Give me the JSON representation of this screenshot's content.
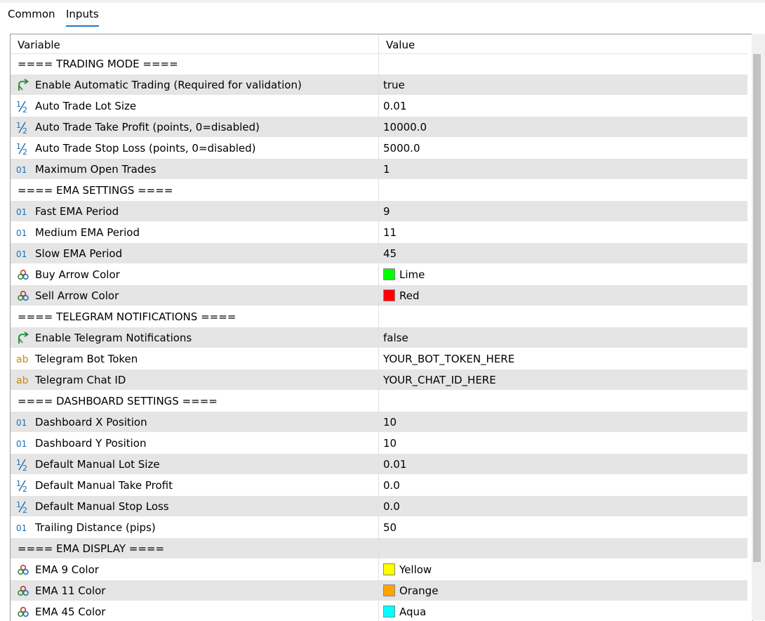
{
  "tabs": [
    {
      "label": "Common",
      "active": false
    },
    {
      "label": "Inputs",
      "active": true
    }
  ],
  "columns": {
    "variable": "Variable",
    "value": "Value"
  },
  "rows": [
    {
      "type": "section",
      "label": "==== TRADING MODE ===="
    },
    {
      "type": "bool",
      "icon": "bool-arrow-icon",
      "label": "Enable Automatic Trading (Required for validation)",
      "value": "true"
    },
    {
      "type": "double",
      "icon": "half-fraction-icon",
      "label": "Auto Trade Lot Size",
      "value": "0.01"
    },
    {
      "type": "double",
      "icon": "half-fraction-icon",
      "label": "Auto Trade Take Profit (points, 0=disabled)",
      "value": "10000.0"
    },
    {
      "type": "double",
      "icon": "half-fraction-icon",
      "label": "Auto Trade Stop Loss (points, 0=disabled)",
      "value": "5000.0"
    },
    {
      "type": "int",
      "icon": "integer-01-icon",
      "label": "Maximum Open Trades",
      "value": "1"
    },
    {
      "type": "section",
      "label": "==== EMA SETTINGS ===="
    },
    {
      "type": "int",
      "icon": "integer-01-icon",
      "label": "Fast EMA Period",
      "value": "9"
    },
    {
      "type": "int",
      "icon": "integer-01-icon",
      "label": "Medium EMA Period",
      "value": "11"
    },
    {
      "type": "int",
      "icon": "integer-01-icon",
      "label": "Slow EMA Period",
      "value": "45"
    },
    {
      "type": "color",
      "icon": "color-circles-icon",
      "label": "Buy Arrow Color",
      "value": "Lime",
      "swatch": "#00ff00"
    },
    {
      "type": "color",
      "icon": "color-circles-icon",
      "label": "Sell Arrow Color",
      "value": "Red",
      "swatch": "#ff0000"
    },
    {
      "type": "section",
      "label": "==== TELEGRAM NOTIFICATIONS ===="
    },
    {
      "type": "bool",
      "icon": "bool-arrow-icon",
      "label": "Enable Telegram Notifications",
      "value": "false"
    },
    {
      "type": "string",
      "icon": "string-ab-icon",
      "label": "Telegram Bot Token",
      "value": "YOUR_BOT_TOKEN_HERE"
    },
    {
      "type": "string",
      "icon": "string-ab-icon",
      "label": "Telegram Chat ID",
      "value": "YOUR_CHAT_ID_HERE"
    },
    {
      "type": "section",
      "label": "==== DASHBOARD SETTINGS ===="
    },
    {
      "type": "int",
      "icon": "integer-01-icon",
      "label": "Dashboard X Position",
      "value": "10"
    },
    {
      "type": "int",
      "icon": "integer-01-icon",
      "label": "Dashboard Y Position",
      "value": "10"
    },
    {
      "type": "double",
      "icon": "half-fraction-icon",
      "label": "Default Manual Lot Size",
      "value": "0.01"
    },
    {
      "type": "double",
      "icon": "half-fraction-icon",
      "label": "Default Manual Take Profit",
      "value": "0.0"
    },
    {
      "type": "double",
      "icon": "half-fraction-icon",
      "label": "Default Manual Stop Loss",
      "value": "0.0"
    },
    {
      "type": "int",
      "icon": "integer-01-icon",
      "label": "Trailing Distance (pips)",
      "value": "50"
    },
    {
      "type": "section",
      "label": "==== EMA DISPLAY ===="
    },
    {
      "type": "color",
      "icon": "color-circles-icon",
      "label": "EMA 9 Color",
      "value": "Yellow",
      "swatch": "#ffff00"
    },
    {
      "type": "color",
      "icon": "color-circles-icon",
      "label": "EMA 11 Color",
      "value": "Orange",
      "swatch": "#ffa500"
    },
    {
      "type": "color",
      "icon": "color-circles-icon",
      "label": "EMA 45 Color",
      "value": "Aqua",
      "swatch": "#00ffff"
    }
  ],
  "colors": {
    "accent": "#1e78c8",
    "row_shade": "#e5e5e5",
    "int_icon": "#1b6fb0",
    "string_icon": "#c78a10",
    "bool_icon": "#1f8a3a"
  }
}
